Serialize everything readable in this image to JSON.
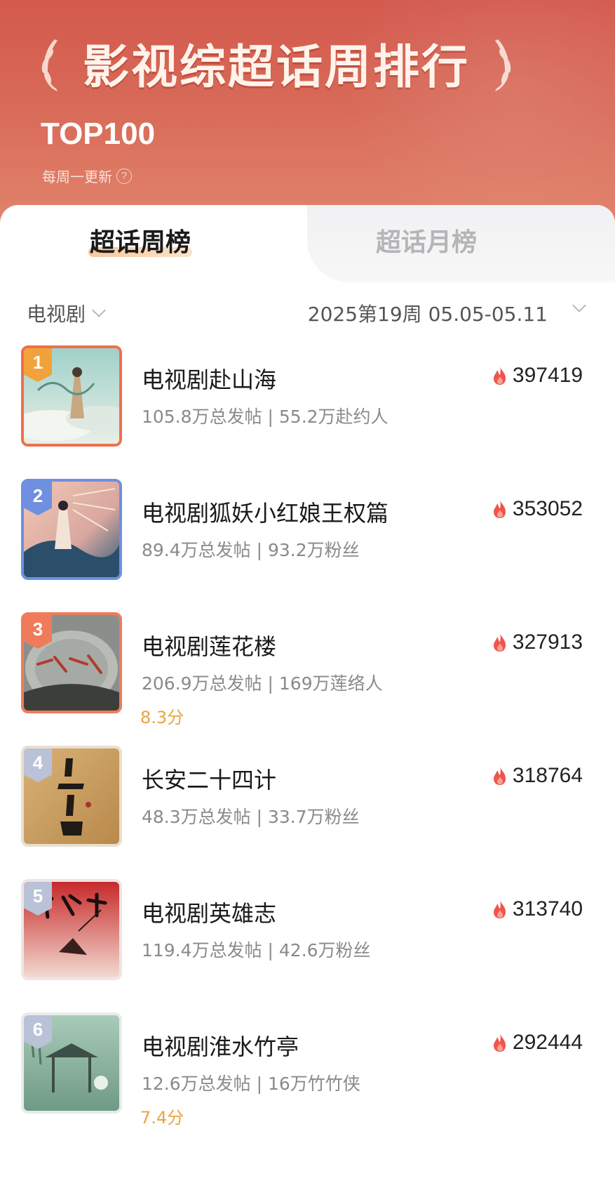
{
  "header": {
    "title": "影视综超话周排行",
    "subtitle": "TOP100",
    "update_note": "每周一更新",
    "help_icon": "?"
  },
  "tabs": [
    {
      "label": "超话周榜",
      "active": true
    },
    {
      "label": "超话月榜",
      "active": false
    }
  ],
  "filter": {
    "category": "电视剧",
    "week": "2025第19周  05.05-05.11"
  },
  "colors": {
    "header_bg": "#d35a4e",
    "accent_orange": "#ef6f4c",
    "rank2": "#6f8fe0",
    "rank4": "#b9c2d6",
    "score": "#e9a441",
    "flame": "#f0544a"
  },
  "items": [
    {
      "rank": "1",
      "title": "电视剧赴山海",
      "meta": "105.8万总发帖 | 55.2万赴约人",
      "score": "",
      "heat": "397419"
    },
    {
      "rank": "2",
      "title": "电视剧狐妖小红娘王权篇",
      "meta": "89.4万总发帖 | 93.2万粉丝",
      "score": "",
      "heat": "353052"
    },
    {
      "rank": "3",
      "title": "电视剧莲花楼",
      "meta": "206.9万总发帖 | 169万莲络人",
      "score": "8.3分",
      "heat": "327913"
    },
    {
      "rank": "4",
      "title": "长安二十四计",
      "meta": "48.3万总发帖 | 33.7万粉丝",
      "score": "",
      "heat": "318764"
    },
    {
      "rank": "5",
      "title": "电视剧英雄志",
      "meta": "119.4万总发帖 | 42.6万粉丝",
      "score": "",
      "heat": "313740"
    },
    {
      "rank": "6",
      "title": "电视剧淮水竹亭",
      "meta": "12.6万总发帖 | 16万竹竹侠",
      "score": "7.4分",
      "heat": "292444"
    }
  ]
}
